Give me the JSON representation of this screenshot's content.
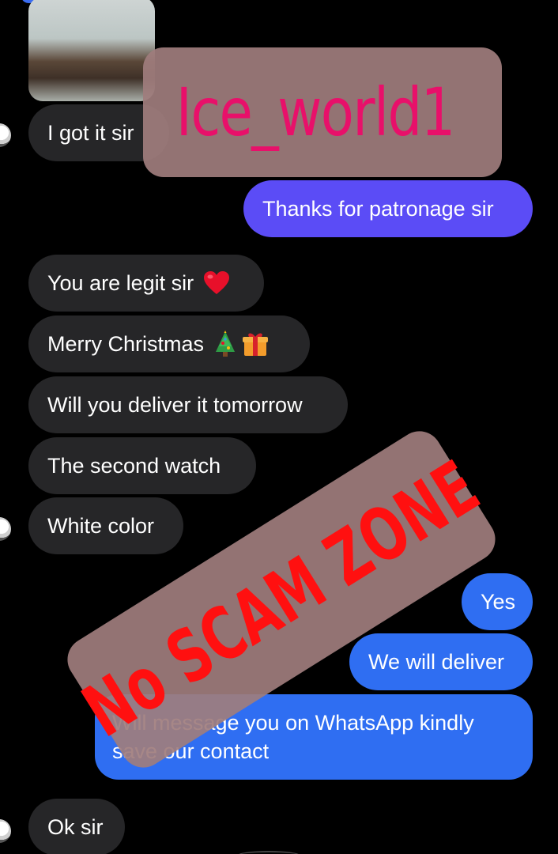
{
  "watermarks": {
    "top_label": "Ice_world1",
    "stamp_label": "No SCAM ZONE"
  },
  "messages": [
    {
      "id": "m1",
      "side": "in",
      "text": "I got it sir"
    },
    {
      "id": "m2",
      "side": "out",
      "text": "Thanks for patronage sir"
    },
    {
      "id": "m3",
      "side": "in",
      "text": "You are legit sir",
      "emoji": "red-heart"
    },
    {
      "id": "m4",
      "side": "in",
      "text": "Merry Christmas",
      "emoji": "christmas-tree-and-gift"
    },
    {
      "id": "m5",
      "side": "in",
      "text": "Will you deliver it tomorrow"
    },
    {
      "id": "m6",
      "side": "in",
      "text": "The second watch"
    },
    {
      "id": "m7",
      "side": "in",
      "text": "White color"
    },
    {
      "id": "m8",
      "side": "out",
      "text": "Yes"
    },
    {
      "id": "m9",
      "side": "out",
      "text": "We will deliver"
    },
    {
      "id": "m10",
      "side": "out",
      "text": "Will message you on WhatsApp kindly save our contact"
    },
    {
      "id": "m11",
      "side": "in",
      "text": "Ok sir"
    }
  ],
  "colors": {
    "background": "#000000",
    "incoming_bubble": "#262628",
    "outgoing_purple": "#5b4cf6",
    "outgoing_blue": "#2f6ef2",
    "watermark_box": "#a07d7d",
    "top_label_color": "#e8106a",
    "stamp_label_color": "#ff1010"
  }
}
